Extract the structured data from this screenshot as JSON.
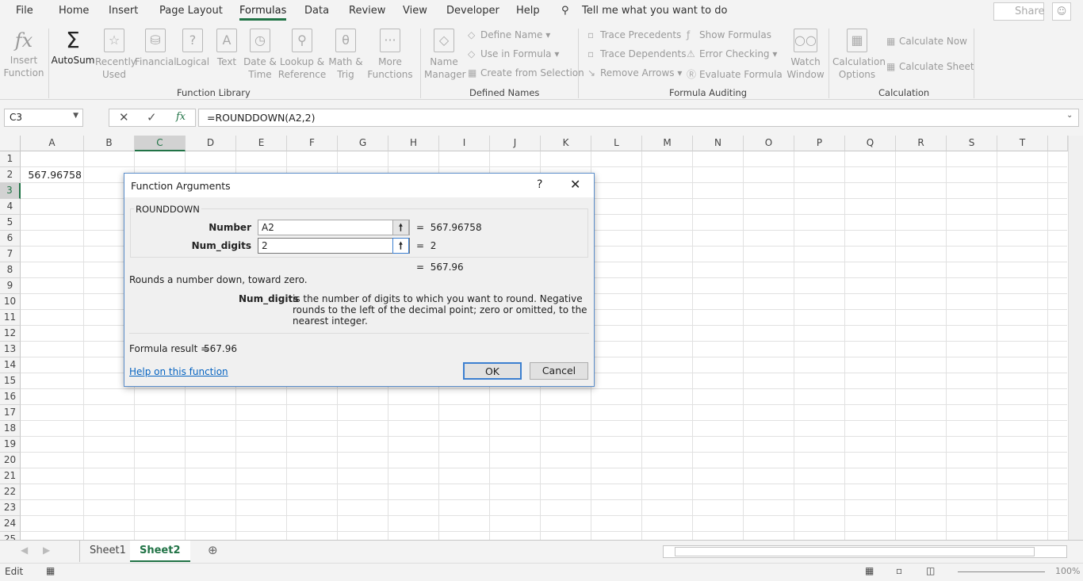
{
  "menu_tabs": [
    "File",
    "Home",
    "Insert",
    "Page Layout",
    "Formulas",
    "Data",
    "Review",
    "View",
    "Developer",
    "Help"
  ],
  "active_tab": "Formulas",
  "tell_me": "Tell me what you want to do",
  "share": "Share",
  "ribbon": {
    "function_library": {
      "label": "Function Library",
      "insert_function": "Insert Function",
      "autosum": "AutoSum",
      "recently_used": "Recently Used",
      "financial": "Financial",
      "logical": "Logical",
      "text": "Text",
      "date_time": "Date & Time",
      "lookup": "Lookup & Reference",
      "math": "Math & Trig",
      "more": "More Functions"
    },
    "defined_names": {
      "label": "Defined Names",
      "name_manager": "Name Manager",
      "define_name": "Define Name",
      "use_in_formula": "Use in Formula",
      "create_from_selection": "Create from Selection"
    },
    "formula_auditing": {
      "label": "Formula Auditing",
      "trace_precedents": "Trace Precedents",
      "trace_dependents": "Trace Dependents",
      "remove_arrows": "Remove Arrows",
      "show_formulas": "Show Formulas",
      "error_checking": "Error Checking",
      "evaluate_formula": "Evaluate Formula",
      "watch_window": "Watch Window"
    },
    "calculation": {
      "label": "Calculation",
      "options": "Calculation Options",
      "calc_now": "Calculate Now",
      "calc_sheet": "Calculate Sheet"
    }
  },
  "name_box": "C3",
  "formula": "=ROUNDDOWN(A2,2)",
  "columns": [
    "A",
    "B",
    "C",
    "D",
    "E",
    "F",
    "G",
    "H",
    "I",
    "J",
    "K",
    "L",
    "M",
    "N",
    "O",
    "P",
    "Q",
    "R",
    "S",
    "T"
  ],
  "selected_column": "C",
  "selected_row": 3,
  "cells": {
    "A2": "567.96758"
  },
  "sheets": [
    "Sheet1",
    "Sheet2"
  ],
  "active_sheet": "Sheet2",
  "status": {
    "mode": "Edit",
    "zoom": "100%"
  },
  "dialog": {
    "title": "Function Arguments",
    "help": "?",
    "function_name": "ROUNDDOWN",
    "args": [
      {
        "label": "Number",
        "value": "A2",
        "result": "567.96758"
      },
      {
        "label": "Num_digits",
        "value": "2",
        "result": "2"
      }
    ],
    "result": "567.96",
    "description": "Rounds a number down, toward zero.",
    "arg_help_name": "Num_digits",
    "arg_help_text": "is the number of digits to which you want to round. Negative rounds to the left of the decimal point; zero or omitted, to the nearest integer.",
    "formula_result_label": "Formula result =",
    "formula_result": "567.96",
    "help_link": "Help on this function",
    "ok": "OK",
    "cancel": "Cancel"
  }
}
